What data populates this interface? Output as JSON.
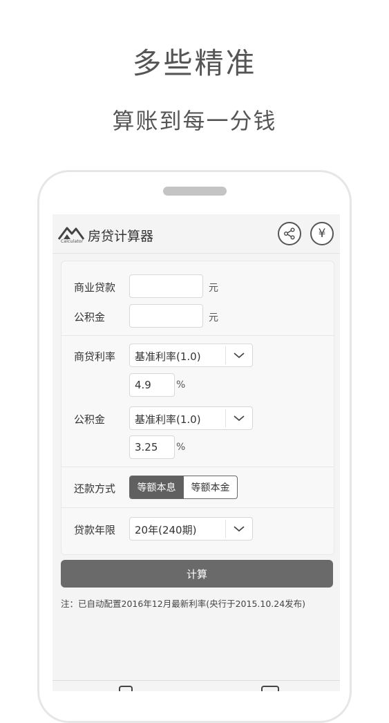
{
  "promo": {
    "headline": "多些精准",
    "subheadline": "算账到每一分钱"
  },
  "app": {
    "title": "房贷计算器",
    "logo_text": "Calculator",
    "share_icon": "share-icon",
    "yuan_symbol": "¥"
  },
  "form": {
    "commercial_loan": {
      "label": "商业贷款",
      "value": "",
      "unit": "元"
    },
    "provident_fund": {
      "label": "公积金",
      "value": "",
      "unit": "元"
    },
    "commercial_rate": {
      "label": "商贷利率",
      "select_value": "基准利率(1.0)",
      "rate": "4.9",
      "unit": "%"
    },
    "provident_rate": {
      "label": "公积金",
      "select_value": "基准利率(1.0)",
      "rate": "3.25",
      "unit": "%"
    },
    "repayment": {
      "label": "还款方式",
      "options": [
        "等额本息",
        "等额本金"
      ],
      "selected": "等额本息"
    },
    "term": {
      "label": "贷款年限",
      "select_value": "20年(240期)"
    }
  },
  "actions": {
    "calculate": "计算"
  },
  "note": "注：已自动配置2016年12月最新利率(央行于2015.10.24发布)",
  "colors": {
    "primary_button": "#6a6a6a",
    "active_segment": "#606060",
    "screen_bg": "#f4f4f4"
  }
}
